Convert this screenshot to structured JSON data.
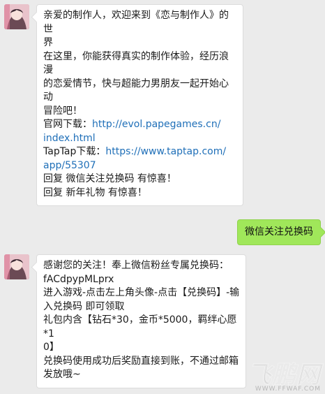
{
  "messages": [
    {
      "sender": "bot",
      "lines": [
        {
          "text": "亲爱的制作人，欢迎来到《恋与制作人》的世"
        },
        {
          "text": "界"
        },
        {
          "text": "在这里，你能获得真实的制作体验，经历浪漫"
        },
        {
          "text": "的恋爱情节，快与超能力男朋友一起开始心动"
        },
        {
          "text": "冒险吧！"
        },
        {
          "prefix": "官网下载：",
          "link": "http://evol.papegames.cn/"
        },
        {
          "link": "index.html"
        },
        {
          "prefix": "TapTap下载：",
          "link": "https://www.taptap.com/"
        },
        {
          "link": "app/55307"
        },
        {
          "text": "回复 微信关注兑换码 有惊喜！"
        },
        {
          "text": "回复 新年礼物 有惊喜！"
        }
      ]
    },
    {
      "sender": "user",
      "text": "微信关注兑换码"
    },
    {
      "sender": "bot",
      "lines": [
        {
          "text": "感谢您的关注！奉上微信粉丝专属兑换码："
        },
        {
          "text": "fACdpypMLprx"
        },
        {
          "text": "进入游戏-点击左上角头像-点击【兑换码】-输"
        },
        {
          "text": "入兑换码 即可领取"
        },
        {
          "text": "礼包内含【钻石*30，金币*5000，羁绊心愿*1"
        },
        {
          "text": "0】"
        },
        {
          "text": "兑换码使用成功后奖励直接到账，不通过邮箱"
        },
        {
          "text": "发放哦~"
        }
      ]
    }
  ],
  "watermark": {
    "main": "飞鹏网",
    "url": "WWW.FFWAF.COM"
  },
  "colors": {
    "background": "#ebebeb",
    "link": "#1f6fb8",
    "sent_bubble": "#a0e75a"
  }
}
